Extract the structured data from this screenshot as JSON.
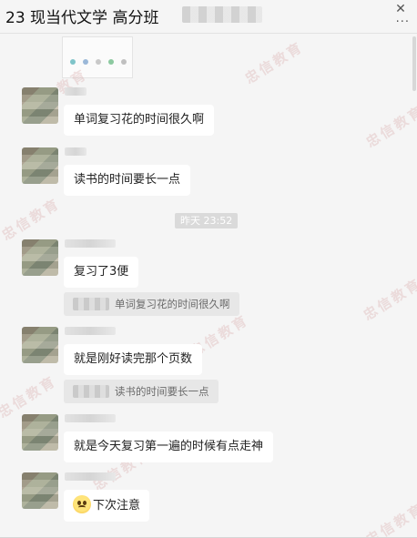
{
  "window": {
    "title": "23 现当代文学 高分班",
    "close_label": "✕",
    "more_label": "···"
  },
  "watermark_text": "忠信教育",
  "timestamp": "昨天 23:52",
  "messages": [
    {
      "text": "单词复习花的时间很久啊"
    },
    {
      "text": "读书的时间要长一点"
    },
    {
      "text": "复习了3便"
    },
    {
      "quote": "单词复习花的时间很久啊"
    },
    {
      "text": "就是刚好读完那个页数"
    },
    {
      "quote": "读书的时间要长一点"
    },
    {
      "text": "就是今天复习第一遍的时候有点走神"
    },
    {
      "text": "下次注意",
      "emoji": "worried-face-icon"
    }
  ],
  "colors": {
    "background": "#f5f5f5",
    "bubble": "#ffffff",
    "quote_bg": "#e7e7e7",
    "timestamp_bg": "#dadada",
    "watermark": "#d29696"
  }
}
